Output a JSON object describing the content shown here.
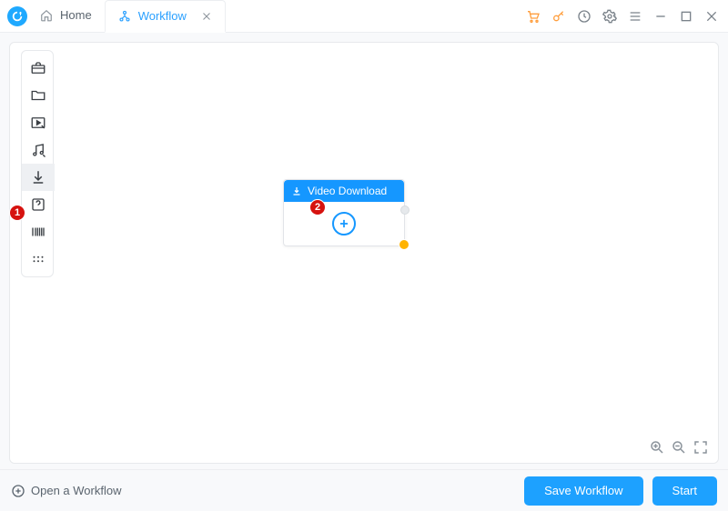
{
  "titlebar": {
    "tabs": {
      "home": "Home",
      "workflow": "Workflow"
    },
    "icons": {
      "cart": "cart-icon",
      "key": "key-icon",
      "history": "history-icon",
      "settings": "settings-icon",
      "menu": "menu-icon",
      "minimize": "minimize-icon",
      "maximize": "maximize-icon",
      "close": "close-icon"
    }
  },
  "toolbar": {
    "items": [
      {
        "name": "toolbox-icon"
      },
      {
        "name": "folder-icon"
      },
      {
        "name": "play-icon"
      },
      {
        "name": "music-icon"
      },
      {
        "name": "download-icon",
        "active": true
      },
      {
        "name": "help-icon"
      },
      {
        "name": "barcode-icon"
      },
      {
        "name": "more-icon"
      }
    ]
  },
  "annotations": {
    "badge1": "1",
    "badge2": "2"
  },
  "node": {
    "title": "Video Download"
  },
  "footer": {
    "open": "Open a Workflow",
    "save": "Save Workflow",
    "start": "Start"
  }
}
